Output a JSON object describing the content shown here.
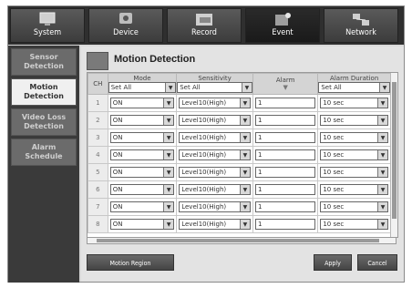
{
  "tabs": [
    {
      "label": "System"
    },
    {
      "label": "Device"
    },
    {
      "label": "Record"
    },
    {
      "label": "Event"
    },
    {
      "label": "Network"
    }
  ],
  "sidebar": {
    "items": [
      {
        "label": "Sensor Detection"
      },
      {
        "label": "Motion Detection"
      },
      {
        "label": "Video Loss Detection"
      },
      {
        "label": "Alarm Schedule"
      }
    ]
  },
  "panel": {
    "title": "Motion Detection",
    "headers": {
      "ch": "CH",
      "mode": "Mode",
      "sensitivity": "Sensitivity",
      "alarm": "Alarm",
      "alarm_duration": "Alarm Duration"
    },
    "header_values": {
      "mode": "Set All",
      "sensitivity": "Set All",
      "alarm_duration": "Set All"
    },
    "rows": [
      {
        "ch": "1",
        "mode": "ON",
        "sensitivity": "Level10(High)",
        "alarm": "1",
        "duration": "10 sec"
      },
      {
        "ch": "2",
        "mode": "ON",
        "sensitivity": "Level10(High)",
        "alarm": "1",
        "duration": "10 sec"
      },
      {
        "ch": "3",
        "mode": "ON",
        "sensitivity": "Level10(High)",
        "alarm": "1",
        "duration": "10 sec"
      },
      {
        "ch": "4",
        "mode": "ON",
        "sensitivity": "Level10(High)",
        "alarm": "1",
        "duration": "10 sec"
      },
      {
        "ch": "5",
        "mode": "ON",
        "sensitivity": "Level10(High)",
        "alarm": "1",
        "duration": "10 sec"
      },
      {
        "ch": "6",
        "mode": "ON",
        "sensitivity": "Level10(High)",
        "alarm": "1",
        "duration": "10 sec"
      },
      {
        "ch": "7",
        "mode": "ON",
        "sensitivity": "Level10(High)",
        "alarm": "1",
        "duration": "10 sec"
      },
      {
        "ch": "8",
        "mode": "ON",
        "sensitivity": "Level10(High)",
        "alarm": "1",
        "duration": "10 sec"
      }
    ],
    "buttons": {
      "motion_region": "Motion Region",
      "apply": "Apply",
      "cancel": "Cancel"
    }
  },
  "icons": {
    "dropdown": "chevron-down-icon",
    "tab_system": "monitor-icon",
    "tab_device": "camera-icon",
    "tab_record": "record-icon",
    "tab_event": "event-icon",
    "tab_network": "network-icon"
  }
}
